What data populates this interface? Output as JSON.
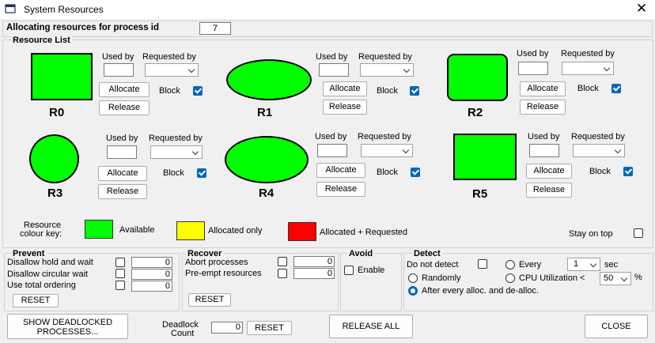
{
  "window": {
    "title": "System Resources"
  },
  "header": {
    "label": "Allocating resources for process id",
    "process_id": "7"
  },
  "resource_list": {
    "title": "Resource List",
    "used_by_label": "Used by",
    "requested_by_label": "Requested by",
    "allocate_label": "Allocate",
    "release_label": "Release",
    "block_label": "Block",
    "resources": [
      {
        "name": "R0",
        "shape": "square",
        "color": "#00ff00",
        "block": true
      },
      {
        "name": "R1",
        "shape": "ellipse",
        "color": "#00ff00",
        "block": true
      },
      {
        "name": "R2",
        "shape": "rounded-square",
        "color": "#00ff00",
        "block": true
      },
      {
        "name": "R3",
        "shape": "circle",
        "color": "#00ff00",
        "block": true
      },
      {
        "name": "R4",
        "shape": "ellipse",
        "color": "#00ff00",
        "block": true
      },
      {
        "name": "R5",
        "shape": "square",
        "color": "#00ff00",
        "block": true
      }
    ]
  },
  "colour_key": {
    "label_line1": "Resource",
    "label_line2": "colour key:",
    "items": [
      {
        "label": "Available",
        "color": "#00ff00"
      },
      {
        "label": "Allocated only",
        "color": "#ffff00"
      },
      {
        "label": "Allocated + Requested",
        "color": "#ff0000"
      }
    ]
  },
  "stay_on_top": {
    "label": "Stay on top",
    "checked": false
  },
  "prevent": {
    "title": "Prevent",
    "items": [
      {
        "label": "Disallow hold and wait",
        "checked": false,
        "value": "0"
      },
      {
        "label": "Disallow circular wait",
        "checked": false,
        "value": "0"
      },
      {
        "label": "Use total ordering",
        "checked": false,
        "value": "0"
      }
    ],
    "reset_label": "RESET"
  },
  "recover": {
    "title": "Recover",
    "items": [
      {
        "label": "Abort processes",
        "checked": false,
        "value": "0"
      },
      {
        "label": "Pre-empt resources",
        "checked": false,
        "value": "0"
      }
    ],
    "reset_label": "RESET"
  },
  "avoid": {
    "title": "Avoid",
    "enable_label": "Enable",
    "checked": false
  },
  "detect": {
    "title": "Detect",
    "do_not_detect_label": "Do not detect",
    "do_not_detect_checked": false,
    "every_label": "Every",
    "every_value": "1",
    "sec_label": "sec",
    "randomly_label": "Randomly",
    "cpu_label": "CPU Utilization <",
    "cpu_value": "50",
    "percent_label": "%",
    "after_label": "After every alloc. and de-alloc.",
    "selected": "after"
  },
  "footer": {
    "show_deadlocked_line1": "SHOW DEADLOCKED",
    "show_deadlocked_line2": "PROCESSES...",
    "deadlock_count_line1": "Deadlock",
    "deadlock_count_line2": "Count",
    "deadlock_count_value": "0",
    "reset_label": "RESET",
    "release_all_label": "RELEASE ALL",
    "close_label": "CLOSE"
  }
}
